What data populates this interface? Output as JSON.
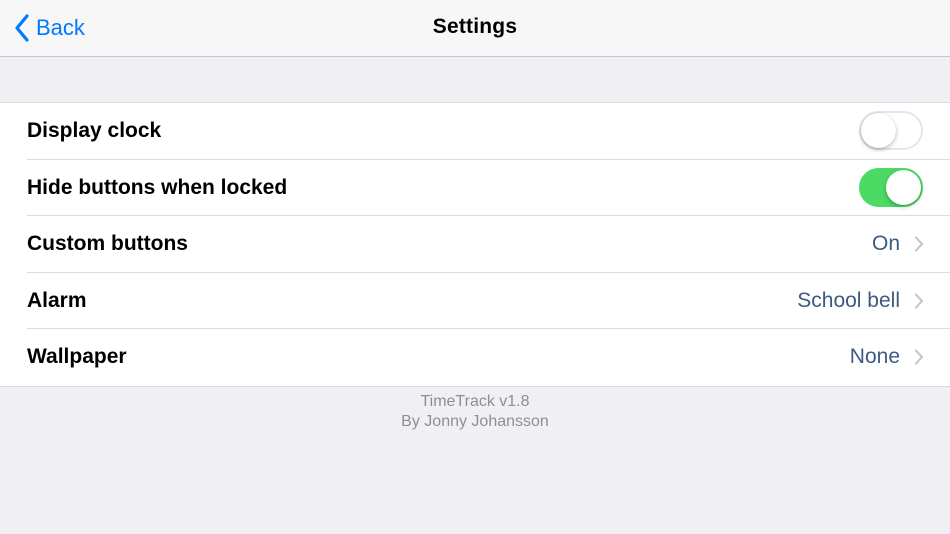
{
  "navbar": {
    "back_label": "Back",
    "title": "Settings"
  },
  "settings": {
    "rows": [
      {
        "label": "Display clock",
        "type": "toggle",
        "on": false
      },
      {
        "label": "Hide buttons when locked",
        "type": "toggle",
        "on": true
      },
      {
        "label": "Custom buttons",
        "type": "disclosure",
        "value": "On"
      },
      {
        "label": "Alarm",
        "type": "disclosure",
        "value": "School bell"
      },
      {
        "label": "Wallpaper",
        "type": "disclosure",
        "value": "None"
      }
    ]
  },
  "footer": {
    "version": "TimeTrack v1.8",
    "author": "By Jonny Johansson"
  },
  "colors": {
    "accent": "#007aff",
    "toggle_on": "#4cd964",
    "value_text": "#3d5a80",
    "background": "#efeff4"
  },
  "icons": {
    "back": "chevron-left-icon",
    "disclosure": "chevron-right-icon"
  }
}
